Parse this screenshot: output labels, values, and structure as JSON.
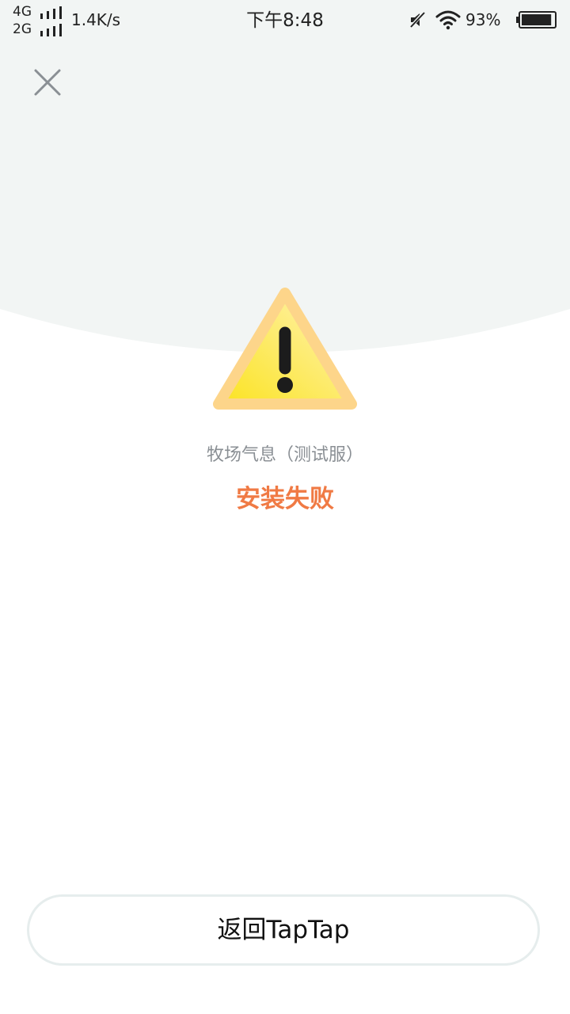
{
  "status_bar": {
    "network_1": "4G",
    "network_2": "2G",
    "speed": "1.4K/s",
    "time": "下午8:48",
    "battery_percent": "93%",
    "battery_level": 0.93,
    "icons": [
      "signal-bars-icon",
      "mute-icon",
      "wifi-icon",
      "battery-icon"
    ]
  },
  "header": {
    "close_icon": "close-icon"
  },
  "main": {
    "icon": "warning-icon",
    "app_name": "牧场气息（测试服）",
    "status_text": "安装失败"
  },
  "footer": {
    "return_label": "返回TapTap"
  },
  "colors": {
    "background_top": "#f2f5f4",
    "background": "#ffffff",
    "accent_error": "#f07a44",
    "subtitle": "#8a8f94",
    "button_border": "#e6eded",
    "warning_fill": "#fde968",
    "warning_border": "#fdd58a"
  }
}
